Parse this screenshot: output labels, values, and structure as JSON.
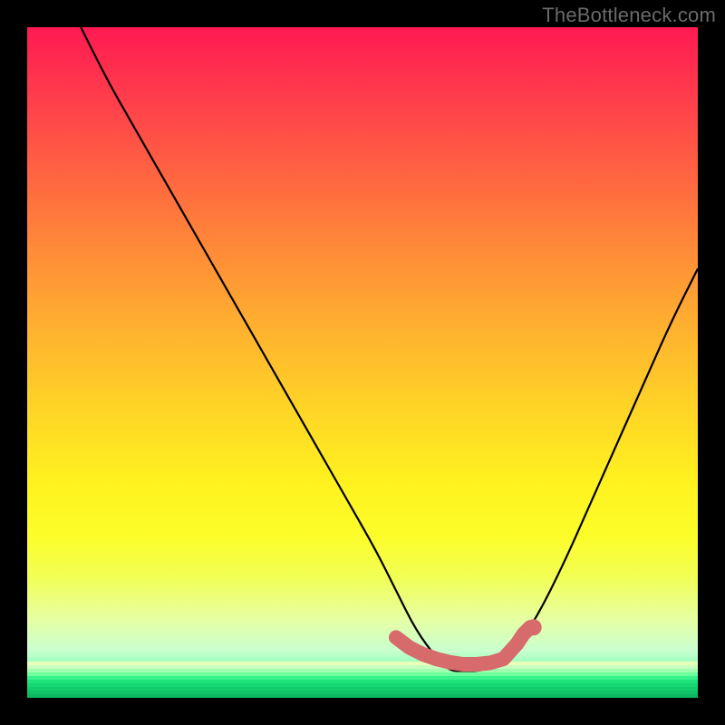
{
  "watermark": "TheBottleneck.com",
  "colors": {
    "frame_bg": "#000000",
    "curve_stroke": "#000000",
    "marker_fill": "#d76a6a",
    "marker_stroke": "#c95a5a"
  },
  "chart_data": {
    "type": "line",
    "title": "",
    "xlabel": "",
    "ylabel": "",
    "xlim": [
      0,
      100
    ],
    "ylim": [
      0,
      100
    ],
    "grid": false,
    "legend": false,
    "annotations": [
      "TheBottleneck.com"
    ],
    "series": [
      {
        "name": "bottleneck-curve",
        "x": [
          8,
          12,
          16,
          20,
          24,
          28,
          32,
          36,
          40,
          44,
          48,
          52,
          55,
          58,
          61,
          63,
          65,
          68,
          72,
          76,
          80,
          84,
          88,
          92,
          96,
          100
        ],
        "y": [
          100,
          92,
          85,
          78,
          71,
          64,
          57,
          50,
          43,
          36,
          29,
          22,
          16,
          10,
          6,
          4,
          4,
          4,
          6,
          12,
          20,
          29,
          38,
          47,
          56,
          64
        ]
      }
    ],
    "markers": {
      "name": "highlight-band",
      "x": [
        55,
        57,
        59,
        61,
        63,
        65,
        67,
        69,
        71,
        73,
        74,
        75
      ],
      "y": [
        9,
        7.5,
        6.5,
        5.8,
        5.3,
        5,
        5,
        5.2,
        5.8,
        8,
        9.5,
        10.5
      ]
    },
    "background_gradient_stops": [
      {
        "pos": 0,
        "color": "#ff1a52"
      },
      {
        "pos": 10,
        "color": "#ff3b4c"
      },
      {
        "pos": 22,
        "color": "#ff6441"
      },
      {
        "pos": 33,
        "color": "#ff8a38"
      },
      {
        "pos": 45,
        "color": "#ffb12f"
      },
      {
        "pos": 57,
        "color": "#ffd526"
      },
      {
        "pos": 68,
        "color": "#fff21f"
      },
      {
        "pos": 76,
        "color": "#fcfd2a"
      },
      {
        "pos": 82,
        "color": "#f2ff55"
      },
      {
        "pos": 88,
        "color": "#e7ffa0"
      },
      {
        "pos": 93,
        "color": "#c9ffd0"
      },
      {
        "pos": 96,
        "color": "#7cffb0"
      },
      {
        "pos": 100,
        "color": "#22e77a"
      }
    ],
    "bottom_stripes": [
      "#e7ffb8",
      "#c8ffc0",
      "#a0ffb0",
      "#6fff9e",
      "#38f28a",
      "#1fe27a",
      "#17d773",
      "#12cc6c",
      "#0fc267",
      "#0cb761"
    ]
  }
}
